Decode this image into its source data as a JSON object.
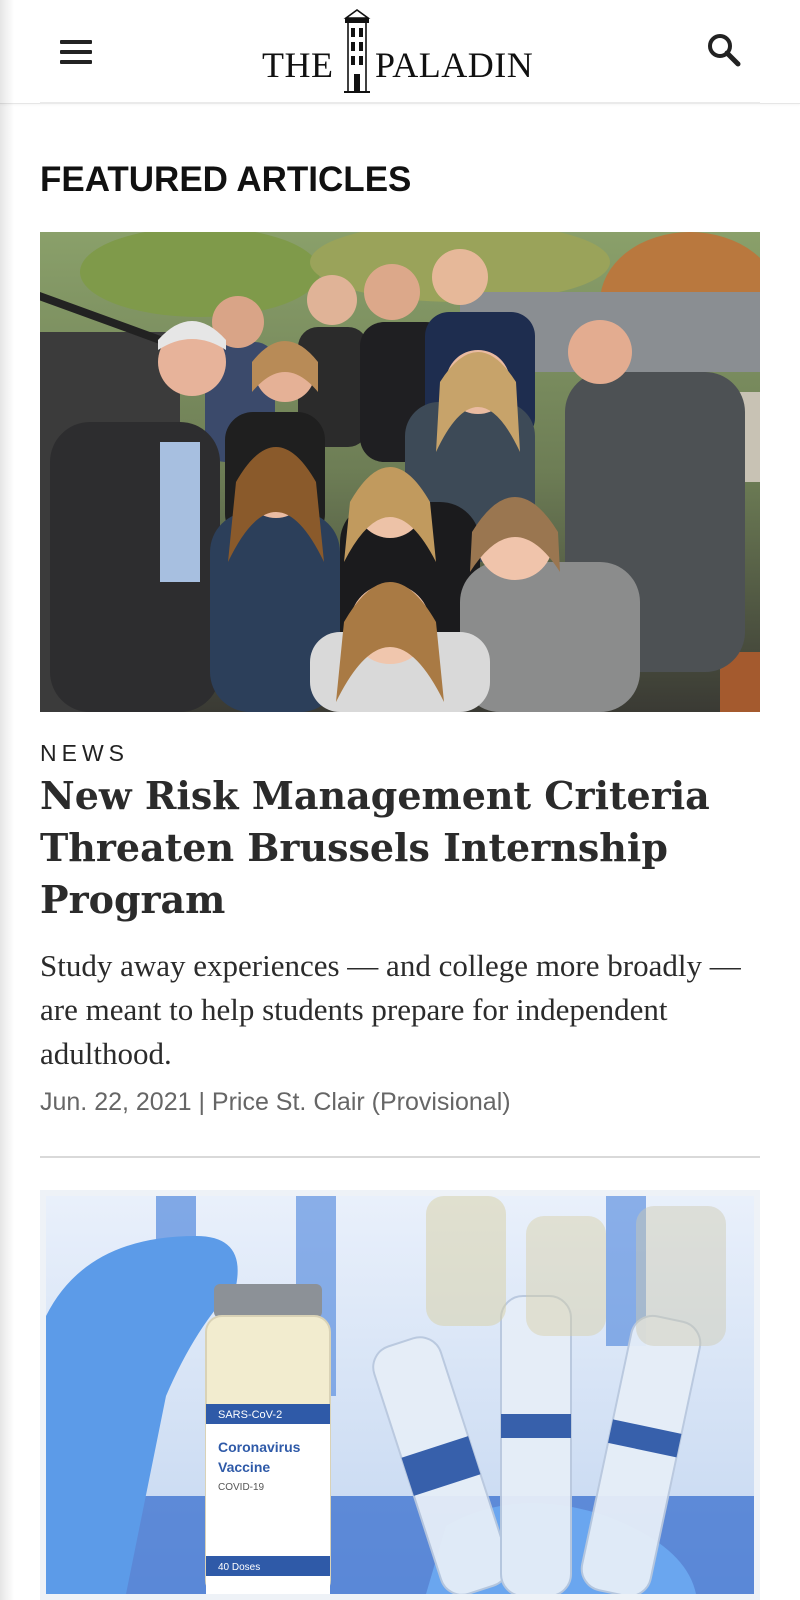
{
  "header": {
    "logo_the": "THE",
    "logo_paladin": "PALADIN",
    "menu_icon": "hamburger-menu-icon",
    "search_icon": "search-icon"
  },
  "featured": {
    "section_title": "FEATURED ARTICLES",
    "articles": [
      {
        "category": "NEWS",
        "headline": "New Risk Management Criteria Threaten Brussels Internship Program",
        "dek": "Study away experiences — and college more broadly — are meant to help students prepare for independent adulthood.",
        "meta": "Jun. 22, 2021 | Price St. Clair (Provisional)"
      }
    ],
    "vaccine_labels": {
      "line1": "SARS-CoV-2",
      "line2": "Coronavirus",
      "line3": "Vaccine",
      "line4": "COVID-19",
      "line5": "40 Doses"
    }
  },
  "colors": {
    "text": "#222222",
    "meta": "#666666",
    "divider": "#d9d9d9",
    "vaccine_blue": "#2f5aa8"
  }
}
